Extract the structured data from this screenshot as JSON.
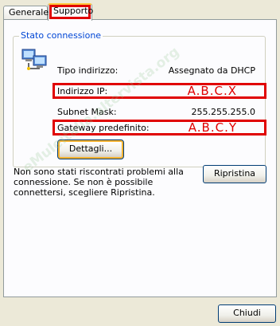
{
  "tabs": [
    {
      "label": "Generale"
    },
    {
      "label": "Supporto"
    }
  ],
  "status": {
    "group_title": "Stato connessione",
    "rows": [
      {
        "label": "Tipo indirizzo:",
        "value": "Assegnato da DHCP"
      },
      {
        "label": "Indirizzo IP:",
        "value": "A.B.C.X"
      },
      {
        "label": "Subnet Mask:",
        "value": "255.255.255.0"
      },
      {
        "label": "Gateway predefinito:",
        "value": "A.B.C.Y"
      }
    ],
    "details_button": "Dettagli..."
  },
  "message": "Non sono stati riscontrati problemi alla connessione. Se non è possibile connettersi, scegliere Ripristina.",
  "repair_button": "Ripristina",
  "close_button": "Chiudi",
  "watermark": "eMuleitalia.altervista.org",
  "colors": {
    "highlight": "#E00000",
    "group_title": "#0046D5",
    "background": "#ECE9D8"
  },
  "icons": {
    "connection": "network-connection-icon"
  }
}
